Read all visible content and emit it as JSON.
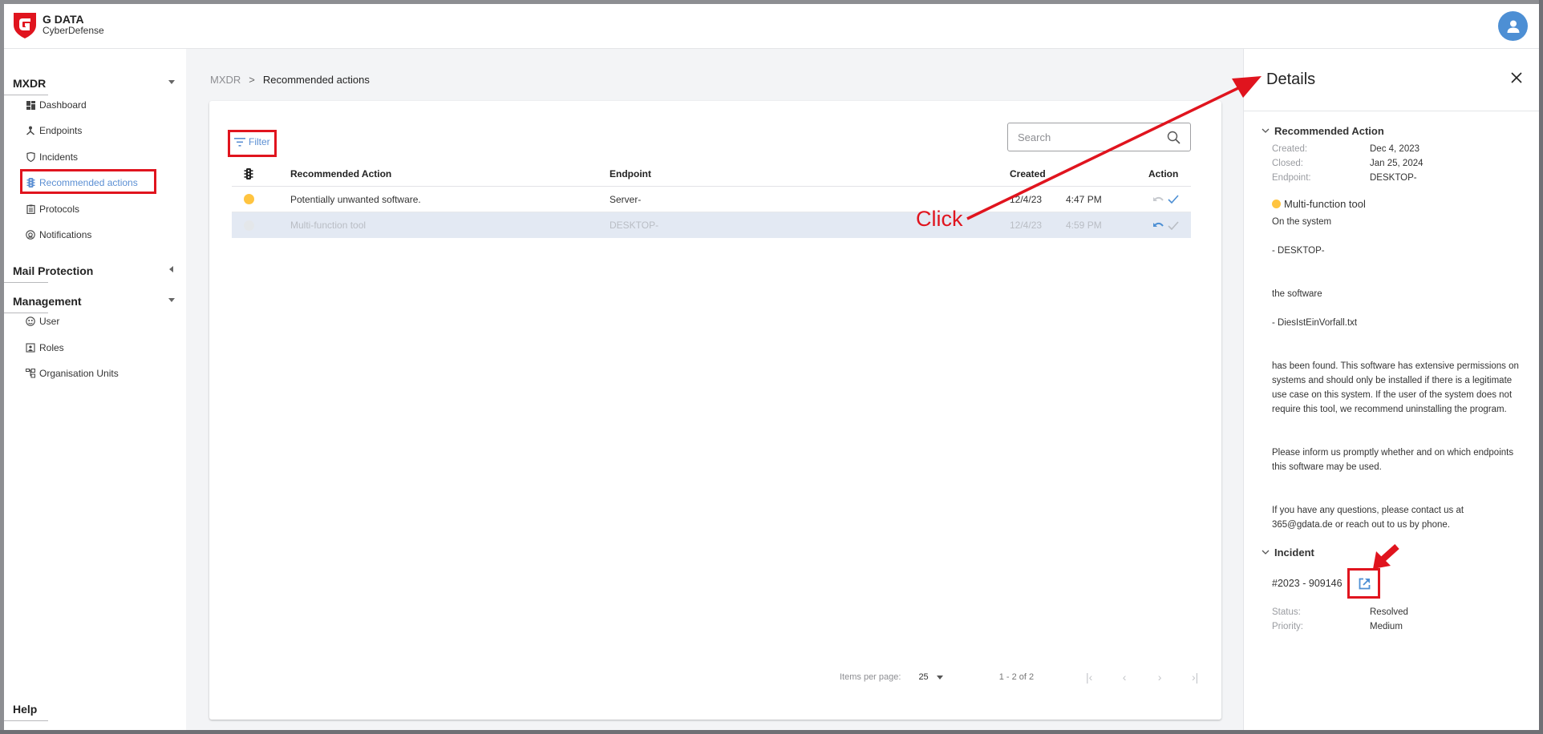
{
  "header": {
    "logo_title": "G DATA",
    "logo_subtitle": "CyberDefense",
    "avatar_icon": "user-icon"
  },
  "sidebar": {
    "sections": [
      {
        "label": "MXDR",
        "expanded": true,
        "items": [
          {
            "label": "Dashboard",
            "icon": "dashboard-icon"
          },
          {
            "label": "Endpoints",
            "icon": "endpoints-icon"
          },
          {
            "label": "Incidents",
            "icon": "shield-icon"
          },
          {
            "label": "Recommended actions",
            "icon": "traffic-light-icon",
            "active": true
          },
          {
            "label": "Protocols",
            "icon": "clipboard-icon"
          },
          {
            "label": "Notifications",
            "icon": "at-icon"
          }
        ]
      },
      {
        "label": "Mail Protection",
        "expanded": false,
        "items": []
      },
      {
        "label": "Management",
        "expanded": true,
        "items": [
          {
            "label": "User",
            "icon": "user-face-icon"
          },
          {
            "label": "Roles",
            "icon": "badge-icon"
          },
          {
            "label": "Organisation Units",
            "icon": "org-units-icon"
          }
        ]
      }
    ],
    "help_label": "Help"
  },
  "breadcrumb": {
    "root": "MXDR",
    "separator": ">",
    "current": "Recommended actions"
  },
  "toolbar": {
    "filter_label": "Filter",
    "search_placeholder": "Search"
  },
  "table": {
    "columns": [
      "",
      "Recommended Action",
      "Endpoint",
      "Created",
      "",
      "Action"
    ],
    "rows": [
      {
        "status_color": "#ffc440",
        "action": "Potentially unwanted software.",
        "endpoint": "Server-",
        "date": "12/4/23",
        "time": "4:47 PM",
        "selected": false
      },
      {
        "status_color": "#e9ecef",
        "action": "Multi-function tool",
        "endpoint": "DESKTOP-",
        "date": "12/4/23",
        "time": "4:59 PM",
        "selected": true
      }
    ]
  },
  "pagination": {
    "items_per_page_label": "Items per page:",
    "items_per_page": "25",
    "range": "1 - 2 of 2"
  },
  "details": {
    "title": "Details",
    "recommended_action": {
      "heading": "Recommended Action",
      "created_label": "Created:",
      "created": "Dec 4, 2023",
      "closed_label": "Closed:",
      "closed": "Jan 25, 2024",
      "endpoint_label": "Endpoint:",
      "endpoint": "DESKTOP-",
      "name": "Multi-function tool",
      "status_color": "#ffc440",
      "text_1": "On the system",
      "text_2": "- DESKTOP-",
      "text_3": "the software",
      "text_4": "- DiesIstEinVorfall.txt",
      "text_5": "has been found. This software has extensive permissions on systems and should only be installed if there is a legitimate use case on this system. If the user of the system does not require this tool, we recommend uninstalling the program.",
      "text_6": "Please inform us promptly whether and on which endpoints this software may be used.",
      "text_7": "If you have any questions, please contact us at 365@gdata.de or reach out to us by phone."
    },
    "incident": {
      "heading": "Incident",
      "id": "#2023 - 909146",
      "status_label": "Status:",
      "status": "Resolved",
      "priority_label": "Priority:",
      "priority": "Medium"
    }
  },
  "annotations": {
    "click_label": "Click",
    "color": "#e0141e"
  }
}
